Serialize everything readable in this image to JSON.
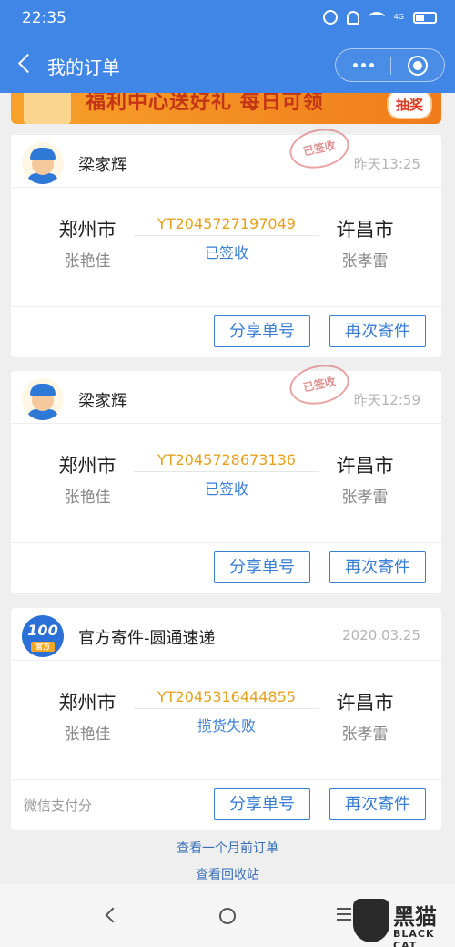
{
  "status_bar": {
    "time": "22:35",
    "network": "4G"
  },
  "nav": {
    "title": "我的订单"
  },
  "banner": {
    "text": "福利中心送好礼 每日可领",
    "button": "抽奖"
  },
  "orders": [
    {
      "sender": "梁家辉",
      "stamp": "已签收",
      "time": "昨天13:25",
      "from_city": "郑州市",
      "from_name": "张艳佳",
      "to_city": "许昌市",
      "to_name": "张孝雷",
      "tracking_no": "YT2045727197049",
      "status": "已签收",
      "share_btn": "分享单号",
      "resend_btn": "再次寄件"
    },
    {
      "sender": "梁家辉",
      "stamp": "已签收",
      "time": "昨天12:59",
      "from_city": "郑州市",
      "from_name": "张艳佳",
      "to_city": "许昌市",
      "to_name": "张孝雷",
      "tracking_no": "YT2045728673136",
      "status": "已签收",
      "share_btn": "分享单号",
      "resend_btn": "再次寄件"
    },
    {
      "sender": "官方寄件-圆通速递",
      "logo_text": "100",
      "logo_sub": "官方",
      "time": "2020.03.25",
      "from_city": "郑州市",
      "from_name": "张艳佳",
      "to_city": "许昌市",
      "to_name": "张孝雷",
      "tracking_no": "YT2045316444855",
      "status": "揽货失败",
      "pay_note": "微信支付分",
      "share_btn": "分享单号",
      "resend_btn": "再次寄件"
    }
  ],
  "links": {
    "older_orders": "查看一个月前订单",
    "recycle": "查看回收站"
  },
  "watermark": {
    "cn": "黑猫",
    "en": "BLACK CAT"
  }
}
